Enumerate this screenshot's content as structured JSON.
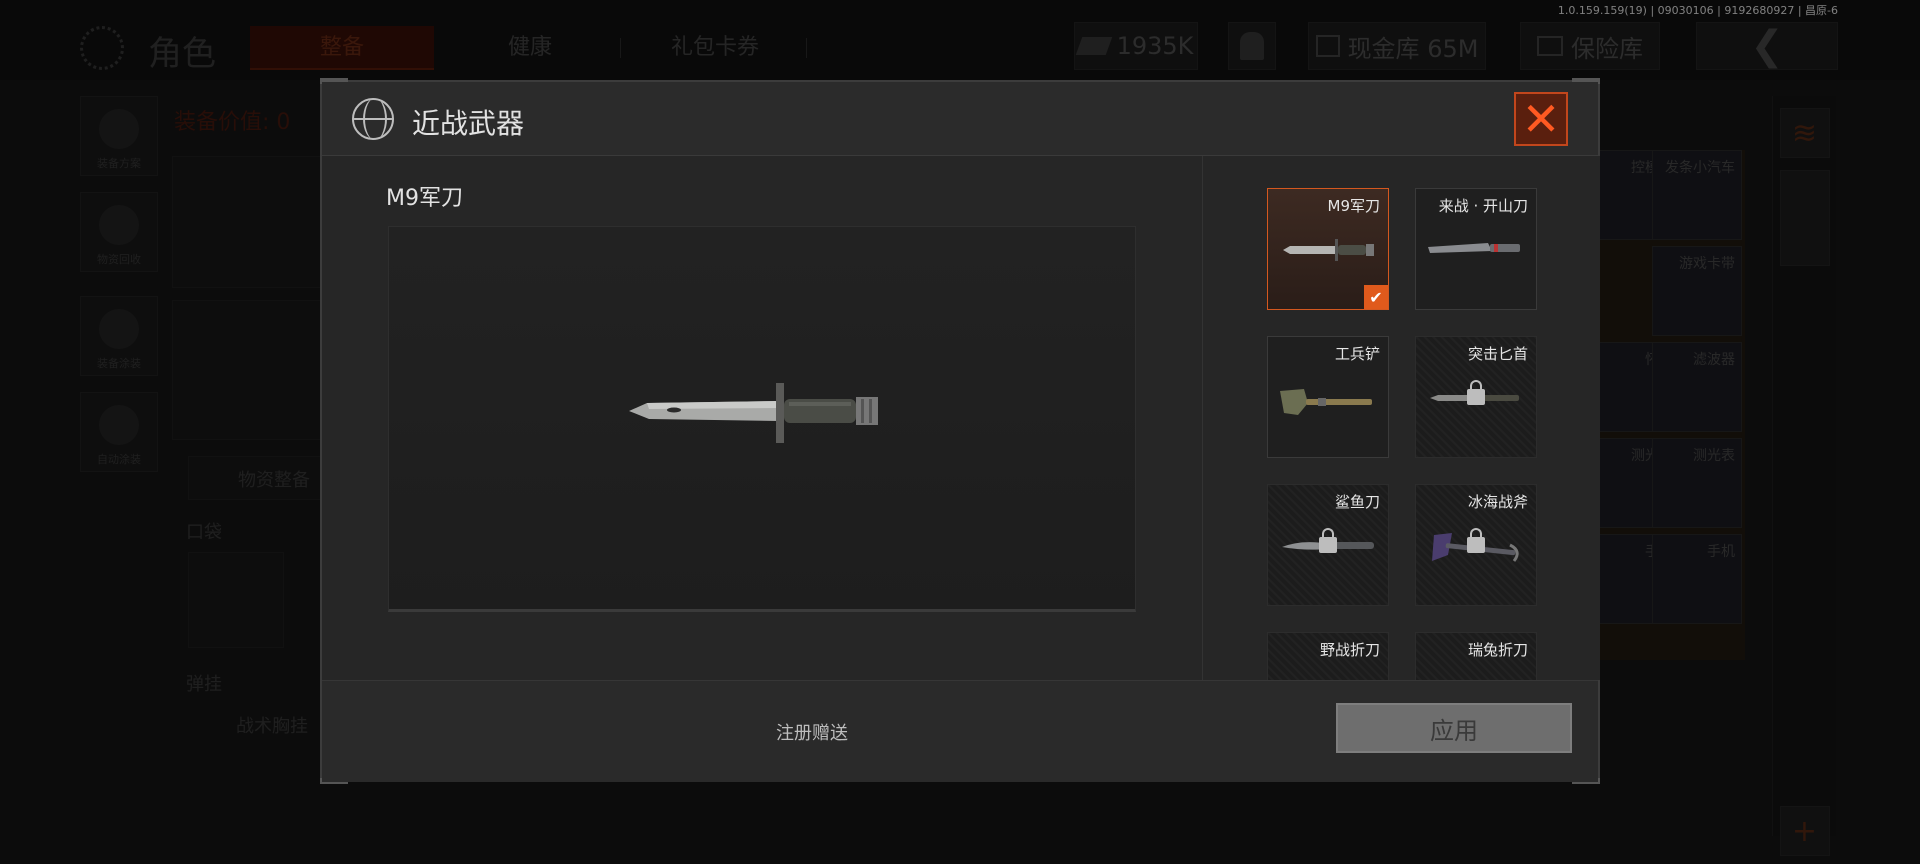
{
  "version_info": "1.0.159.159(19) | 09030106 | 9192680927 | 昌原-6",
  "header": {
    "title": "角色",
    "tabs": [
      "整备",
      "健康",
      "礼包卡券"
    ],
    "currency": "1935K",
    "cash_vault": "现金库 65M",
    "safe_box": "保险库"
  },
  "left_menu": [
    "装备方案",
    "物资回收",
    "装备涂装",
    "自动涂装"
  ],
  "background": {
    "equip_value": "装备价值: 0",
    "supply_prep": "物资整备",
    "pocket": "口袋",
    "rig": "弹挂",
    "tactical_vest": "战术胸挂"
  },
  "right_grid_labels": [
    "控模块",
    "发条小汽车",
    "游戏卡带",
    "怀表",
    "滤波器",
    "测光表",
    "测光表",
    "手机",
    "手机"
  ],
  "modal": {
    "title": "近战武器",
    "selected_name": "M9军刀",
    "footer_text": "注册赠送",
    "apply_label": "应用",
    "weapons": [
      {
        "label": "M9军刀",
        "state": "selected",
        "icon": "bayonet-icon"
      },
      {
        "label": "来战 · 开山刀",
        "state": "owned",
        "icon": "machete-icon"
      },
      {
        "label": "工兵铲",
        "state": "owned",
        "icon": "shovel-icon"
      },
      {
        "label": "突击匕首",
        "state": "locked",
        "icon": "dagger-icon"
      },
      {
        "label": "鲨鱼刀",
        "state": "locked",
        "icon": "shark-knife-icon"
      },
      {
        "label": "冰海战斧",
        "state": "locked",
        "icon": "axe-icon"
      },
      {
        "label": "野战折刀",
        "state": "locked",
        "icon": "folding-knife-icon"
      },
      {
        "label": "瑞兔折刀",
        "state": "locked",
        "icon": "folding-knife-icon"
      }
    ]
  },
  "colors": {
    "accent": "#e05a1c",
    "close": "#ff5a22",
    "panel": "#262626"
  }
}
